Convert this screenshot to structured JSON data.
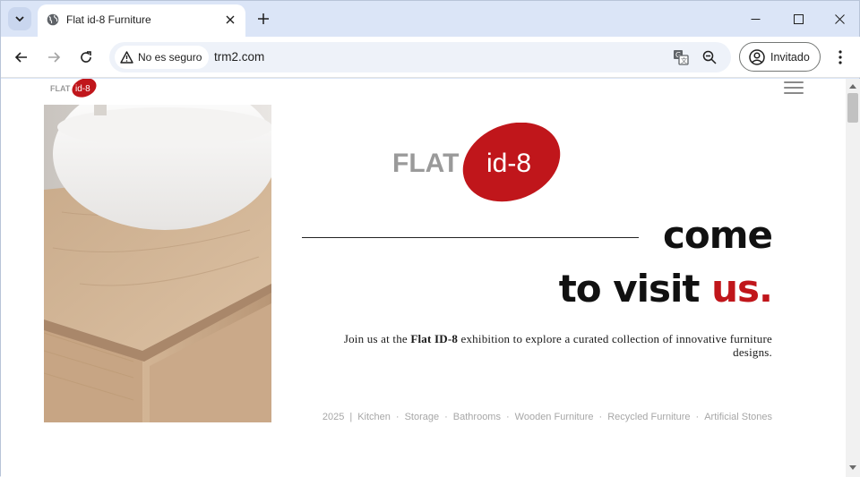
{
  "browser": {
    "tab_title": "Flat id-8 Furniture",
    "security_label": "No es seguro",
    "url": "trm2.com",
    "profile_label": "Invitado",
    "icons": [
      "tab-search-icon",
      "globe-icon",
      "close-icon",
      "plus-icon",
      "minimize-icon",
      "maximize-icon",
      "window-close-icon",
      "back-icon",
      "forward-icon",
      "reload-icon",
      "warning-icon",
      "translate-icon",
      "zoom-icon",
      "profile-icon",
      "more-icon"
    ]
  },
  "page": {
    "logo_small": {
      "word": "FLAT",
      "mark": "id-8"
    },
    "logo_big": {
      "word": "FLAT",
      "mark": "id-8"
    },
    "headline_line1": "come",
    "headline_line2_main": "to visit ",
    "headline_line2_accent": "us.",
    "blurb_prefix": "Join us at the ",
    "blurb_bold": "Flat ID-8",
    "blurb_suffix": " exhibition to explore a curated collection of innovative furniture designs.",
    "tags": [
      "2025",
      "Kitchen",
      "Storage",
      "Bathrooms",
      "Wooden Furniture",
      "Recycled Furniture",
      "Artificial Stones"
    ],
    "tag_first_separator": "|",
    "tag_separator": "·",
    "colors": {
      "accent": "#c0161b",
      "logo_grey": "#9a9a9a",
      "tag_grey": "#a7a7a7"
    }
  }
}
